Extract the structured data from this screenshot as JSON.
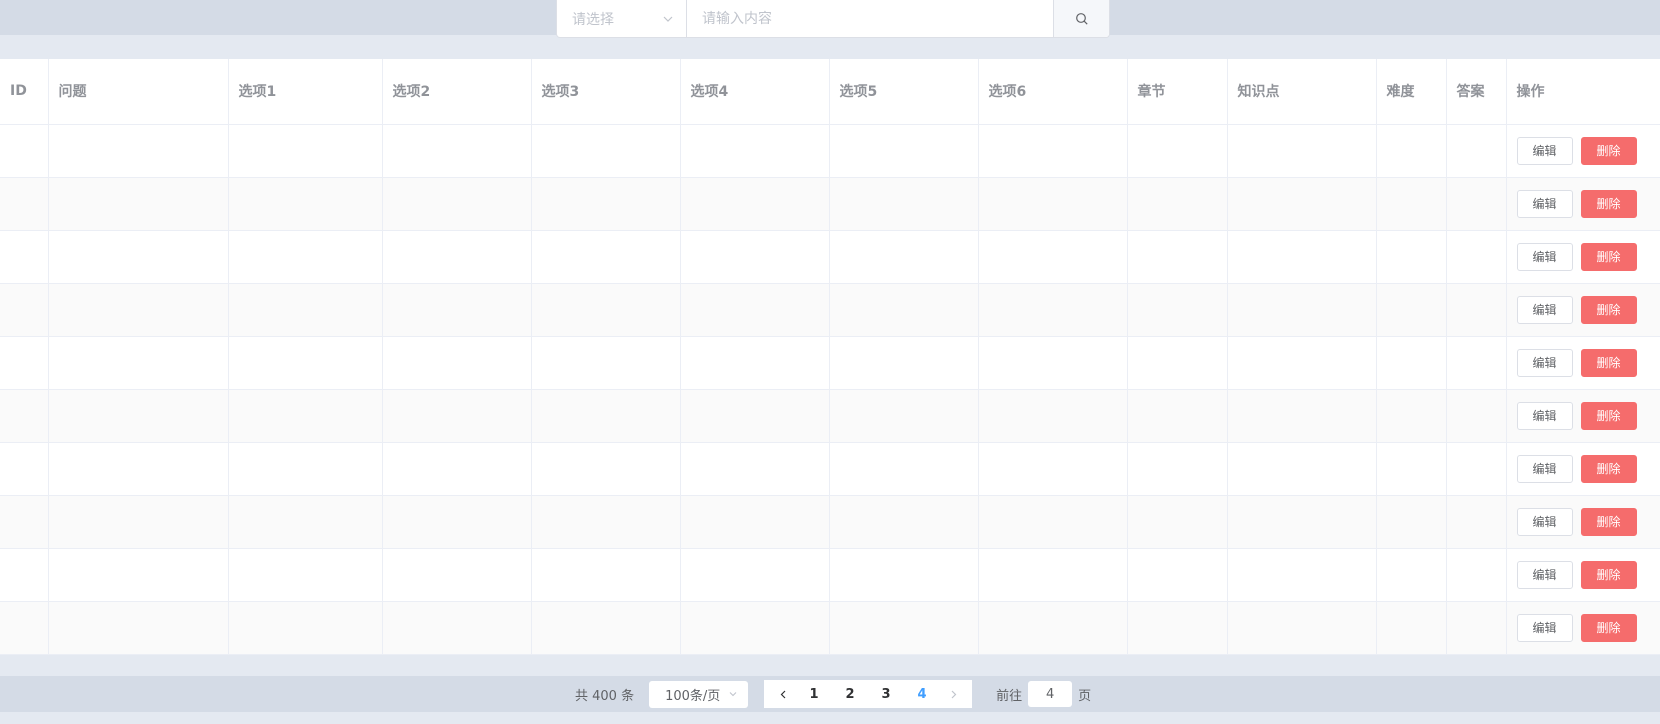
{
  "search": {
    "select_placeholder": "请选择",
    "input_placeholder": "请输入内容"
  },
  "table": {
    "columns": [
      "ID",
      "问题",
      "选项1",
      "选项2",
      "选项3",
      "选项4",
      "选项5",
      "选项6",
      "章节",
      "知识点",
      "难度",
      "答案",
      "操作"
    ],
    "row_count": 10,
    "edit_label": "编辑",
    "delete_label": "删除"
  },
  "pagination": {
    "total": "共 400 条",
    "page_size": "100条/页",
    "pages": [
      "1",
      "2",
      "3",
      "4"
    ],
    "current_page": "4",
    "goto_label": "前往",
    "goto_value": "4",
    "goto_suffix": "页"
  },
  "colors": {
    "accent": "#409eff",
    "danger": "#f56c6c",
    "header_bg": "#d4dbe6",
    "page_bg": "#e4e9f1"
  },
  "icons": {
    "select_arrow": "chevron-down-icon",
    "search": "search-icon",
    "prev": "chevron-left-icon",
    "next": "chevron-right-icon"
  }
}
